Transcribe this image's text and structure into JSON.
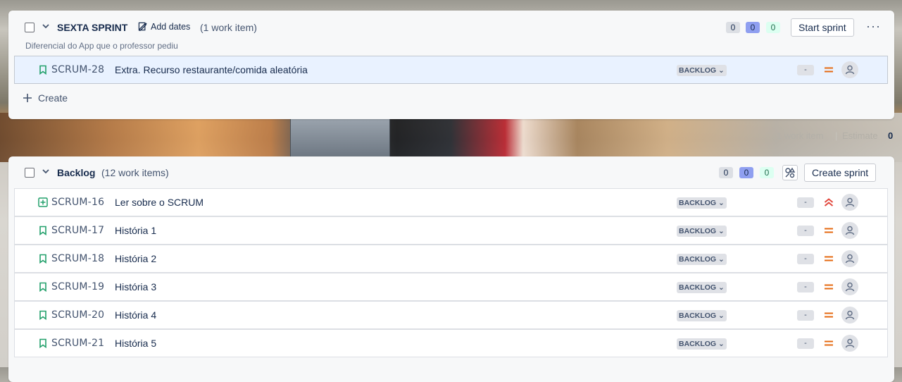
{
  "sprint": {
    "title": "SEXTA SPRINT",
    "add_dates_label": "Add dates",
    "count_label": "(1 work item)",
    "goal": "Diferencial do App que o professor pediu",
    "counters": [
      "0",
      "0",
      "0"
    ],
    "start_button": "Start sprint",
    "more_label": "···",
    "items": [
      {
        "key": "SCRUM-28",
        "summary": "Extra. Recurso restaurante/comida aleatória",
        "status": "BACKLOG",
        "estimate": "-",
        "priority": "medium",
        "type": "story"
      }
    ],
    "create_label": "Create",
    "footer_count": "1 work item",
    "footer_estimate_label": "Estimate",
    "footer_estimate_value": "0"
  },
  "backlog": {
    "title": "Backlog",
    "count_label": "(12 work items)",
    "counters": [
      "0",
      "0",
      "0"
    ],
    "create_sprint_button": "Create sprint",
    "items": [
      {
        "key": "SCRUM-16",
        "summary": "Ler sobre o SCRUM",
        "status": "BACKLOG",
        "estimate": "-",
        "priority": "highest",
        "type": "subtask"
      },
      {
        "key": "SCRUM-17",
        "summary": "História 1",
        "status": "BACKLOG",
        "estimate": "-",
        "priority": "medium",
        "type": "story"
      },
      {
        "key": "SCRUM-18",
        "summary": "História 2",
        "status": "BACKLOG",
        "estimate": "-",
        "priority": "medium",
        "type": "story"
      },
      {
        "key": "SCRUM-19",
        "summary": "História 3",
        "status": "BACKLOG",
        "estimate": "-",
        "priority": "medium",
        "type": "story"
      },
      {
        "key": "SCRUM-20",
        "summary": "História 4",
        "status": "BACKLOG",
        "estimate": "-",
        "priority": "medium",
        "type": "story"
      },
      {
        "key": "SCRUM-21",
        "summary": "História 5",
        "status": "BACKLOG",
        "estimate": "-",
        "priority": "medium",
        "type": "story"
      }
    ]
  },
  "colors": {
    "story": "#22a06b",
    "priority_medium": "#e56910",
    "priority_highest": "#e2483d"
  }
}
